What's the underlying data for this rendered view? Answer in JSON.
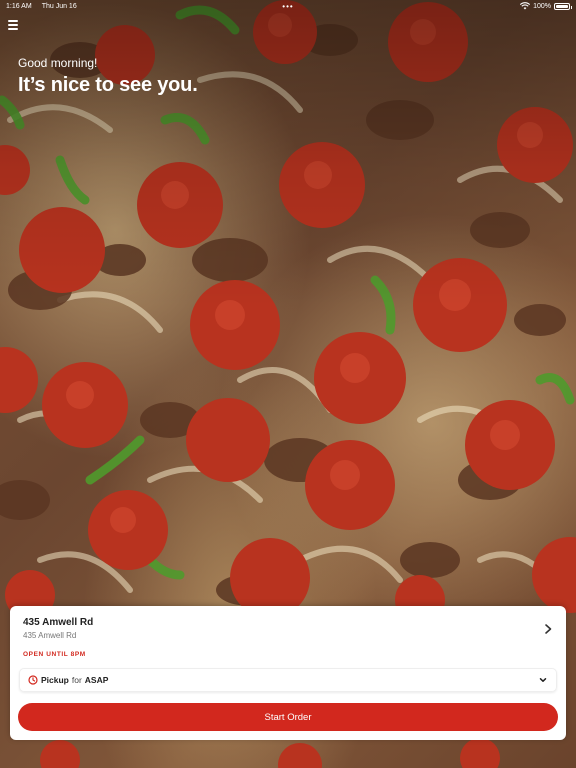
{
  "status_bar": {
    "time": "1:16 AM",
    "date": "Thu Jun 16",
    "center_dots": "•••",
    "battery_text": "100%",
    "battery_level": 1.0
  },
  "header": {
    "menu_icon": "hamburger-menu-icon",
    "greeting": "Good morning!",
    "headline": "It’s nice to see you."
  },
  "store": {
    "name": "435 Amwell Rd",
    "address": "435 Amwell Rd",
    "hours": "OPEN UNTIL 8PM"
  },
  "order_mode": {
    "icon": "clock-icon",
    "method": "Pickup",
    "connector": "for",
    "time": "ASAP"
  },
  "cta": {
    "label": "Start Order"
  },
  "colors": {
    "accent": "#d2281e",
    "card": "#ffffff"
  }
}
